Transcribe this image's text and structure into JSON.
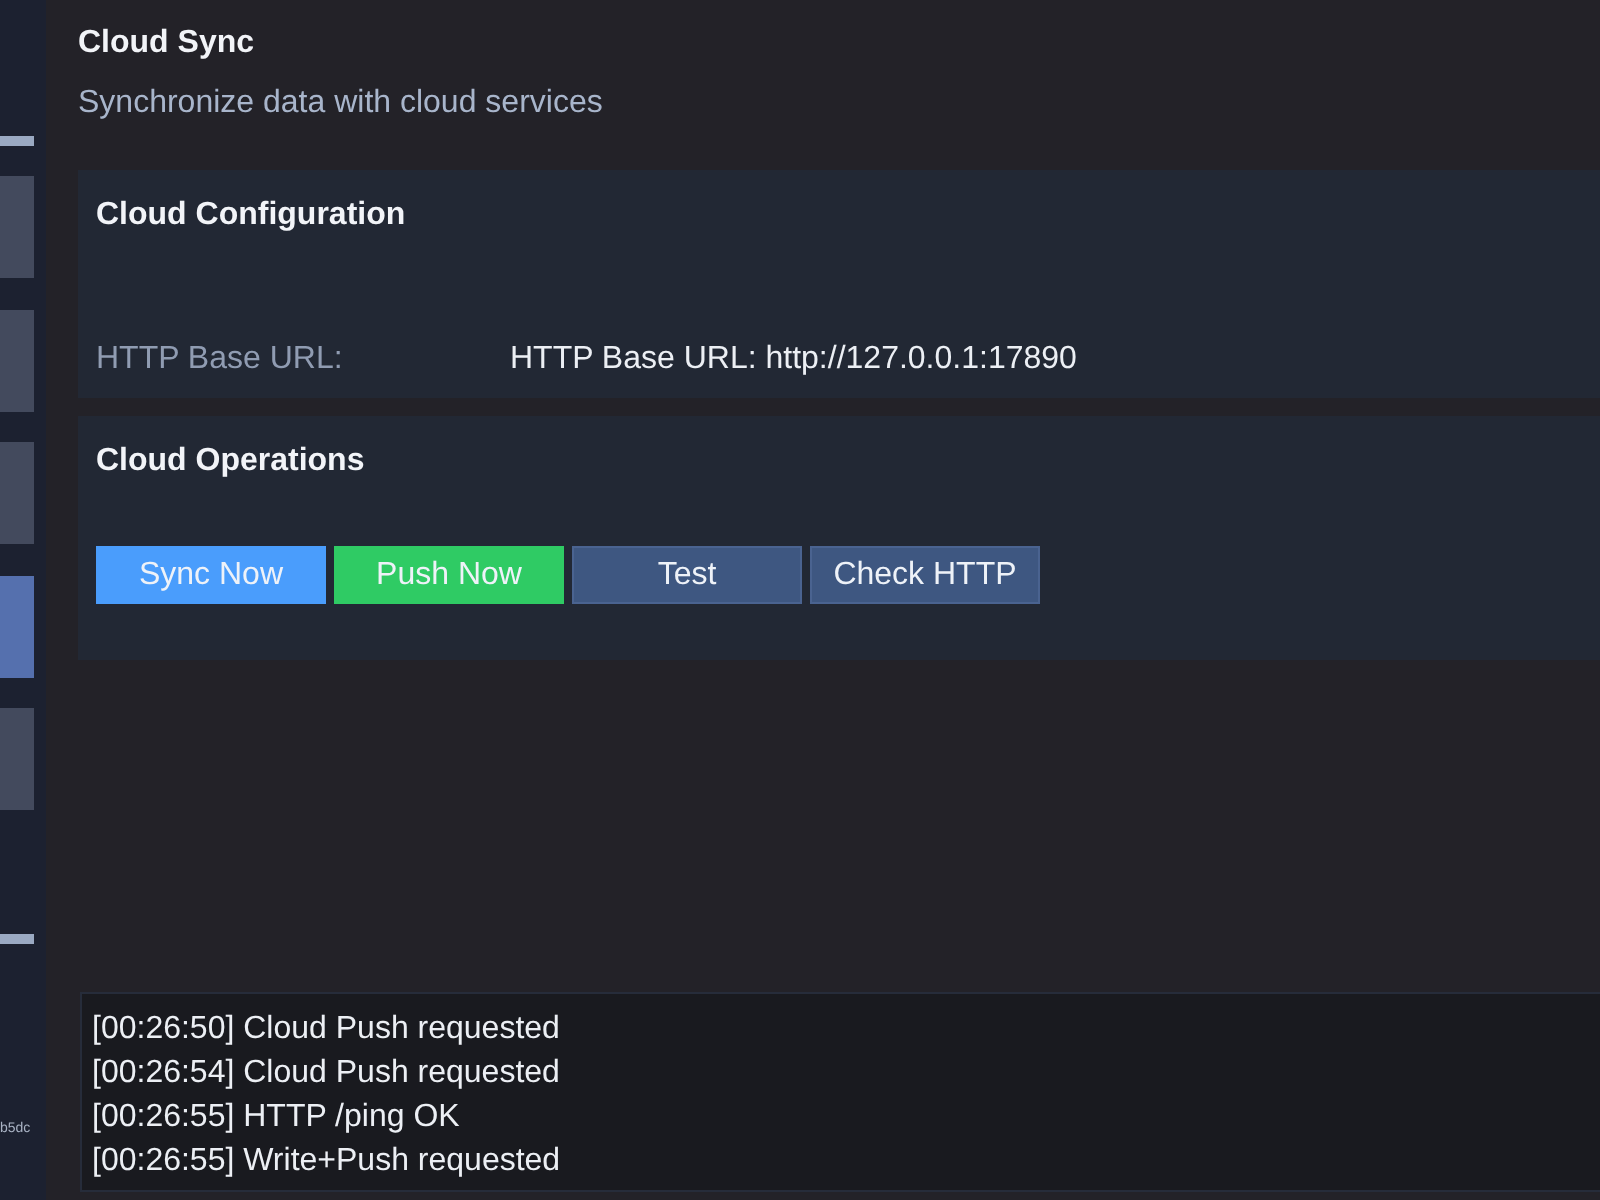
{
  "sidebar": {
    "items": [
      {
        "selected": false
      },
      {
        "selected": false
      },
      {
        "selected": false
      },
      {
        "selected": true
      },
      {
        "selected": false
      }
    ],
    "footer_text": "b5dc"
  },
  "page": {
    "title": "Cloud Sync",
    "subtitle": "Synchronize data with cloud services"
  },
  "config_card": {
    "title": "Cloud Configuration",
    "fields": [
      {
        "label": "HTTP Base URL:",
        "value": "HTTP Base URL: http://127.0.0.1:17890"
      }
    ]
  },
  "operations_card": {
    "title": "Cloud Operations",
    "buttons": [
      {
        "label": "Sync Now",
        "kind": "primary"
      },
      {
        "label": "Push Now",
        "kind": "success"
      },
      {
        "label": "Test",
        "kind": "secondary"
      },
      {
        "label": "Check HTTP",
        "kind": "secondary"
      }
    ]
  },
  "log": {
    "lines": [
      "[00:26:50] Cloud Push requested",
      "[00:26:54] Cloud Push requested",
      "[00:26:55] HTTP /ping OK",
      "[00:26:55] Write+Push requested"
    ]
  }
}
